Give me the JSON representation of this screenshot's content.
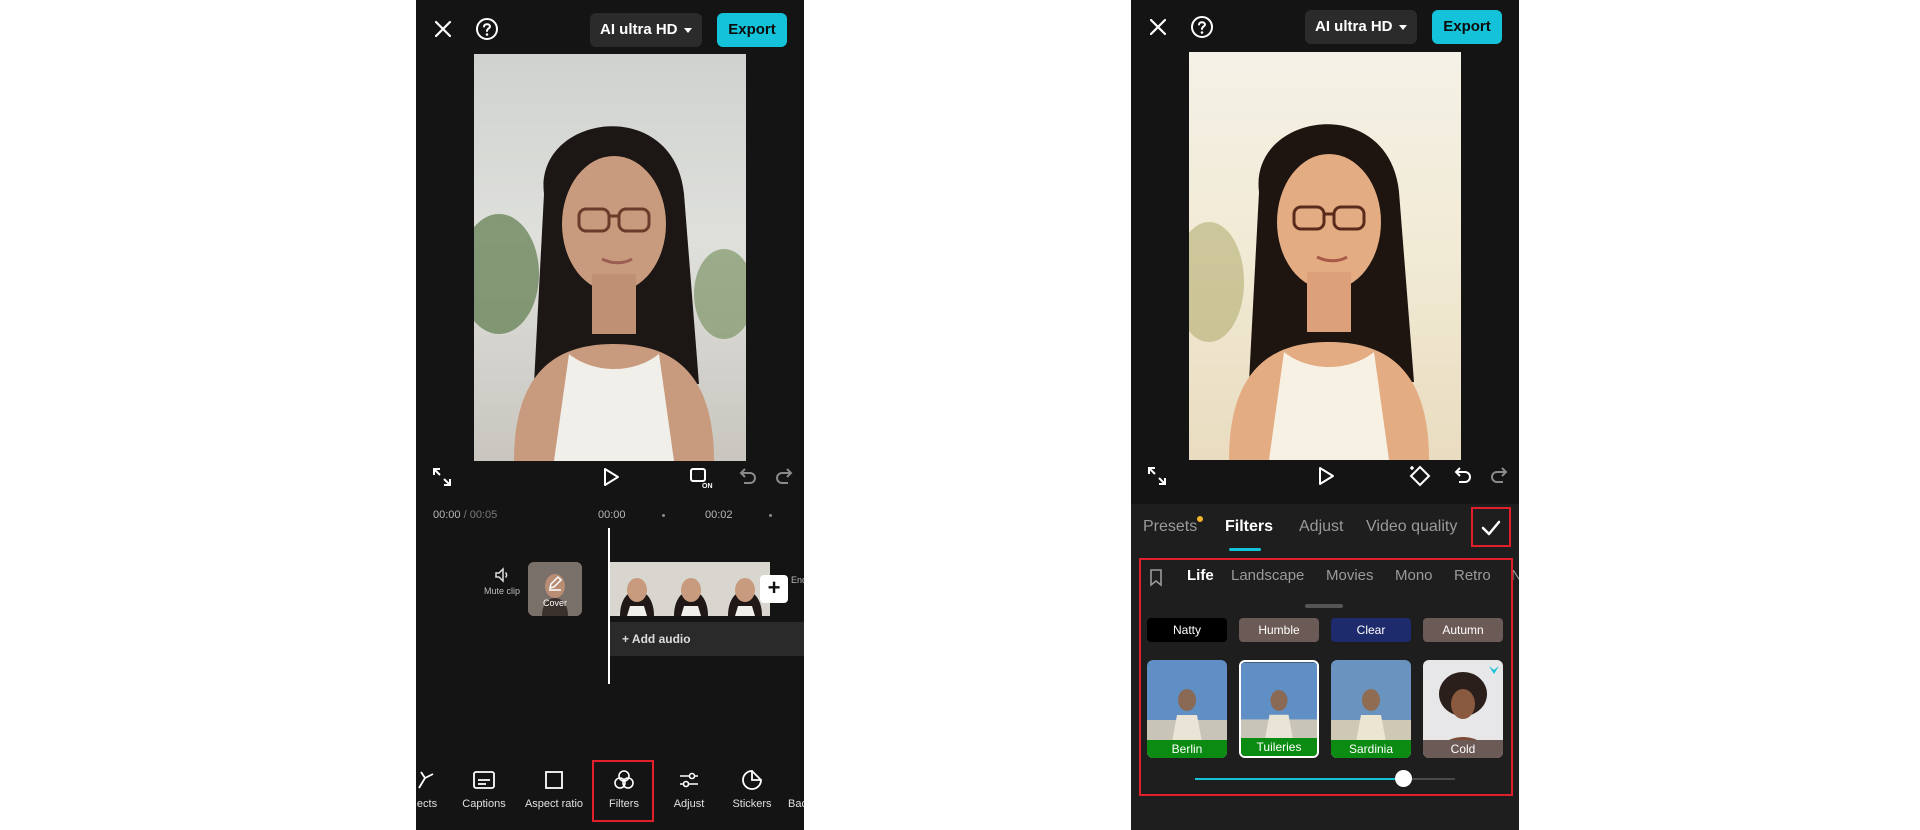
{
  "colors": {
    "accent": "#14c3d9",
    "highlight": "#e1202b",
    "background": "#141414",
    "panel": "#1e1e1e"
  },
  "left": {
    "topbar": {
      "close_icon": "close-icon",
      "help_icon": "help-icon",
      "quality_label": "AI ultra HD",
      "export_label": "Export"
    },
    "controls": [
      "fullscreen-icon",
      "play-icon",
      "original-audio-on-icon",
      "undo-icon",
      "redo-icon"
    ],
    "timeline": {
      "current_time": "00:00",
      "total_time": " / 00:05",
      "ruler_ticks": [
        "00:00",
        "00:02"
      ],
      "mute_label": "Mute clip",
      "cover_label": "Cover",
      "add_audio_label": "Add audio",
      "end_label": "Enc"
    },
    "toolbar": [
      {
        "icon": "effects-icon",
        "label": "ects"
      },
      {
        "icon": "captions-icon",
        "label": "Captions"
      },
      {
        "icon": "aspect-ratio-icon",
        "label": "Aspect ratio"
      },
      {
        "icon": "filters-icon",
        "label": "Filters"
      },
      {
        "icon": "adjust-icon",
        "label": "Adjust"
      },
      {
        "icon": "stickers-icon",
        "label": "Stickers"
      },
      {
        "icon": "background-icon",
        "label": "Bac"
      }
    ]
  },
  "right": {
    "topbar": {
      "close_icon": "close-icon",
      "help_icon": "help-icon",
      "quality_label": "AI ultra HD",
      "export_label": "Export"
    },
    "controls": [
      "fullscreen-icon",
      "play-icon",
      "keyframe-icon",
      "undo-icon",
      "redo-icon"
    ],
    "tabs": [
      "Presets",
      "Filters",
      "Adjust",
      "Video quality"
    ],
    "active_tab": "Filters",
    "categories": [
      "Life",
      "Landscape",
      "Movies",
      "Mono",
      "Retro",
      "N"
    ],
    "active_category": "Life",
    "chips": [
      {
        "label": "Natty",
        "color": "#000000"
      },
      {
        "label": "Humble",
        "color": "#6b5a55"
      },
      {
        "label": "Clear",
        "color": "#1d2a6b"
      },
      {
        "label": "Autumn",
        "color": "#6b5a55"
      }
    ],
    "filters": [
      {
        "label": "Berlin",
        "label_color": "#0c8b12"
      },
      {
        "label": "Tuileries",
        "label_color": "#0c8b12"
      },
      {
        "label": "Sardinia",
        "label_color": "#0c8b12"
      },
      {
        "label": "Cold",
        "label_color": "#6b5a55"
      }
    ],
    "selected_filter": "Tuileries",
    "intensity_fraction": 0.8
  }
}
